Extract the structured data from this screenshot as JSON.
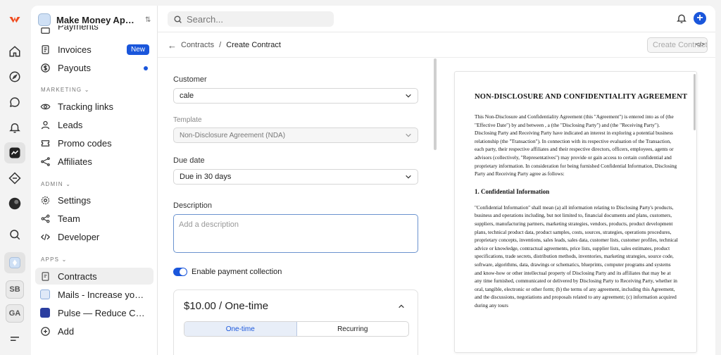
{
  "store": {
    "name": "Make Money App B..."
  },
  "sidebar": {
    "items_top": [
      {
        "label": "Payments"
      },
      {
        "label": "Invoices",
        "badge": "New"
      },
      {
        "label": "Payouts"
      }
    ],
    "marketing_title": "MARKETING",
    "marketing": [
      {
        "label": "Tracking links"
      },
      {
        "label": "Leads"
      },
      {
        "label": "Promo codes"
      },
      {
        "label": "Affiliates"
      }
    ],
    "admin_title": "ADMIN",
    "admin": [
      {
        "label": "Settings"
      },
      {
        "label": "Team"
      },
      {
        "label": "Developer"
      }
    ],
    "apps_title": "APPS",
    "apps": [
      {
        "label": "Contracts"
      },
      {
        "label": "Mails - Increase your..."
      },
      {
        "label": "Pulse — Reduce Churn"
      },
      {
        "label": "Add"
      }
    ]
  },
  "rail": {
    "badges": [
      "SB",
      "GA"
    ]
  },
  "header": {
    "search_placeholder": "Search..."
  },
  "breadcrumb": {
    "parent": "Contracts",
    "separator": "/",
    "current": "Create Contract"
  },
  "actions": {
    "create_label": "Create Contract"
  },
  "form": {
    "customer_label": "Customer",
    "customer_value": "cale",
    "template_label": "Template",
    "template_value": "Non-Disclosure Agreement (NDA)",
    "due_label": "Due date",
    "due_value": "Due in 30 days",
    "description_label": "Description",
    "description_placeholder": "Add a description",
    "payment_toggle_label": "Enable payment collection",
    "price_title": "$10.00 / One-time",
    "segment_onetime": "One-time",
    "segment_recurring": "Recurring"
  },
  "document": {
    "title": "NON-DISCLOSURE AND CONFIDENTIALITY AGREEMENT",
    "intro": "This Non-Disclosure and Confidentiality Agreement (this \"Agreement\") is entered into as of (the \"Effective Date\") by and between , a (the \"Disclosing Party\") and (the \"Receiving Party\").",
    "recital": "Disclosing Party and Receiving Party have indicated an interest in exploring a potential business relationship (the \"Transaction\"). In connection with its respective evaluation of the Transaction, each party, their respective affiliates and their respective directors, officers, employees, agents or advisors (collectively, \"Representatives\") may provide or gain access to certain confidential and proprietary information. In consideration for being furnished Confidential Information, Disclosing Party and Receiving Party agree as follows:",
    "section1_title": "1. Confidential Information",
    "section1_body": "\"Confidential Information\" shall mean (a) all information relating to Disclosing Party's products, business and operations including, but not limited to, financial documents and plans, customers, suppliers, manufacturing partners, marketing strategies, vendors, products, product development plans, technical product data, product samples, costs, sources, strategies, operations procedures, proprietary concepts, inventions, sales leads, sales data, customer lists, customer profiles, technical advice or knowledge, contractual agreements, price lists, supplier lists, sales estimates, product specifications, trade secrets, distribution methods, inventories, marketing strategies, source code, software, algorithms, data, drawings or schematics, blueprints, computer programs and systems and know-how or other intellectual property of Disclosing Party and its affiliates that may be at any time furnished, communicated or delivered by Disclosing Party to Receiving Party, whether in oral, tangible, electronic or other form; (b) the terms of any agreement, including this Agreement, and the discussions, negotiations and proposals related to any agreement; (c) information acquired during any tours"
  }
}
